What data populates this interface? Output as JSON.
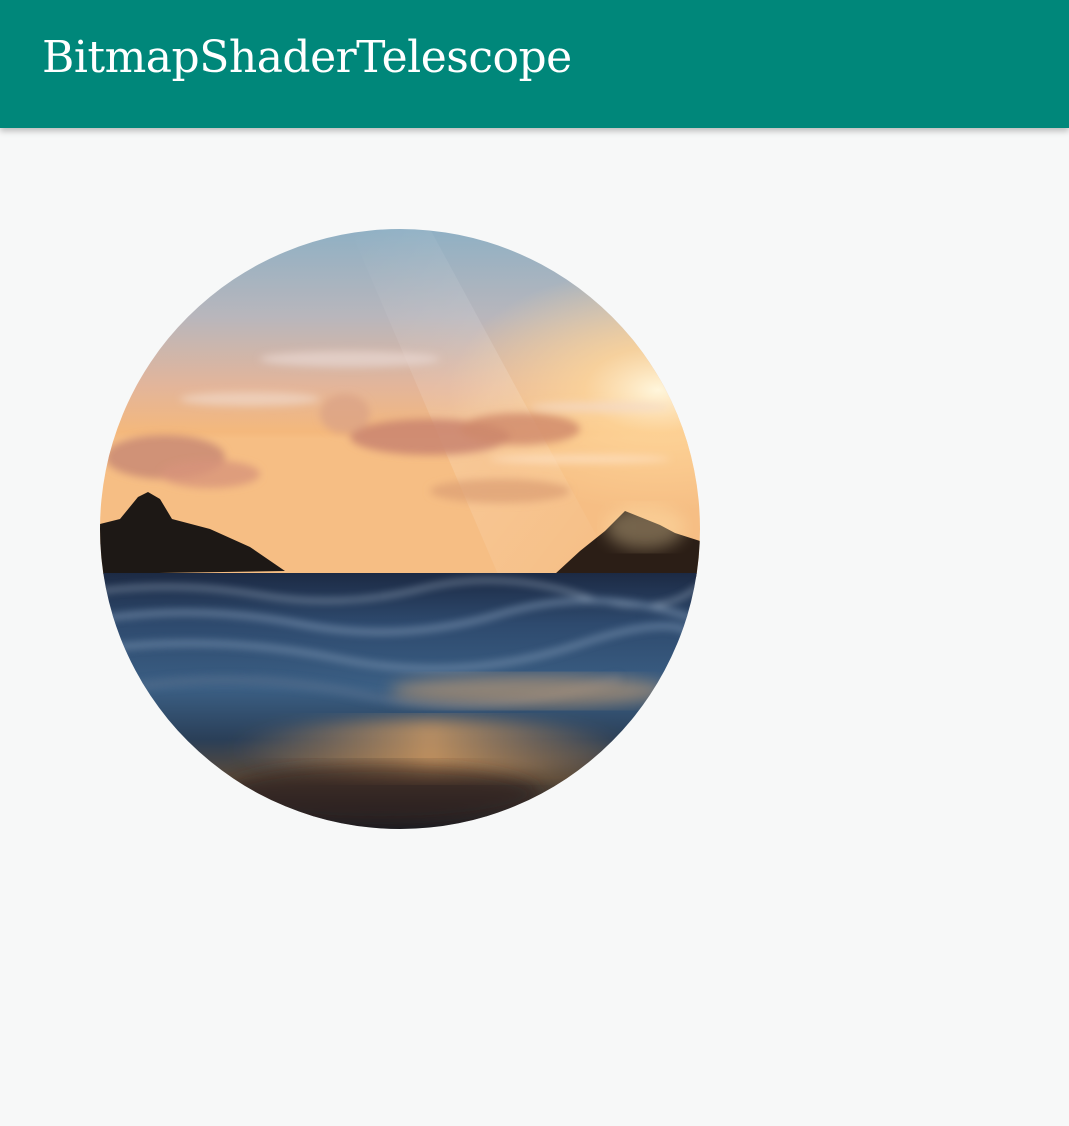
{
  "app_bar": {
    "title": "BitmapShaderTelescope",
    "color": "#00877a"
  },
  "content": {
    "background": "#f7f8f8"
  },
  "telescope_view": {
    "icon": "circular-image-lens",
    "scene": "sunset-ocean-islands"
  }
}
